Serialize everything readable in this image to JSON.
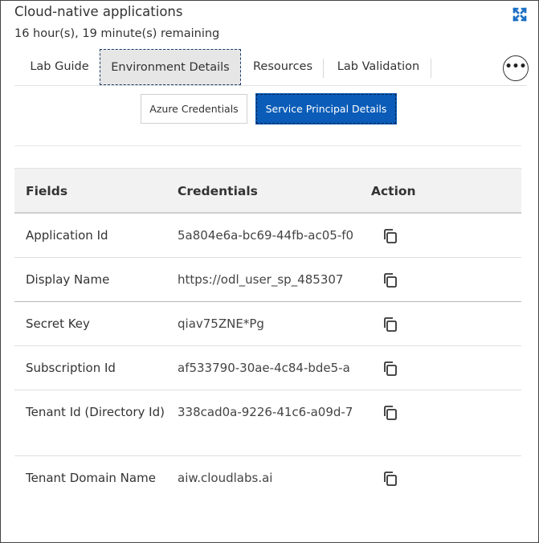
{
  "header": {
    "title": "Cloud-native applications",
    "time_remaining": "16 hour(s), 19 minute(s) remaining"
  },
  "tabs": [
    {
      "label": "Lab Guide",
      "active": false
    },
    {
      "label": "Environment Details",
      "active": true
    },
    {
      "label": "Resources",
      "active": false
    },
    {
      "label": "Lab Validation",
      "active": false
    }
  ],
  "more_label": "•••",
  "subtabs": {
    "azure": "Azure Credentials",
    "service_principal": "Service Principal Details",
    "active": "service_principal"
  },
  "table": {
    "headers": {
      "fields": "Fields",
      "credentials": "Credentials",
      "action": "Action"
    },
    "rows": [
      {
        "field": "Application Id",
        "credential": "5a804e6a-bc69-44fb-ac05-f0",
        "action_icon": "copy-icon"
      },
      {
        "field": "Display Name",
        "credential": "https://odl_user_sp_485307",
        "action_icon": "copy-icon"
      },
      {
        "field": "Secret Key",
        "credential": "qiav75ZNE*Pg",
        "action_icon": "copy-icon"
      },
      {
        "field": "Subscription Id",
        "credential": "af533790-30ae-4c84-bde5-a",
        "action_icon": "copy-icon"
      },
      {
        "field": "Tenant Id (Directory Id)",
        "credential": "338cad0a-9226-41c6-a09d-7",
        "action_icon": "copy-icon"
      },
      {
        "field": "Tenant Domain Name",
        "credential": "aiw.cloudlabs.ai",
        "action_icon": "copy-icon"
      }
    ]
  },
  "colors": {
    "accent": "#0a5cb8",
    "expand_icon": "#1a6fc4"
  }
}
